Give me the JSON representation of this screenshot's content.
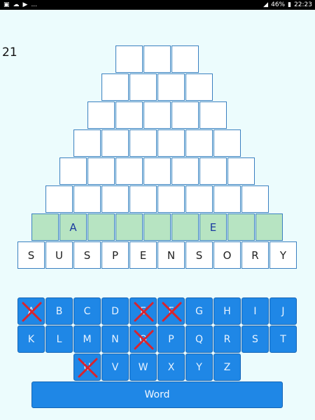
{
  "status_bar": {
    "left_icons": [
      "image-icon",
      "cloud-icon",
      "play-icon"
    ],
    "left_more": "...",
    "battery": "46%",
    "time": "22:23"
  },
  "game": {
    "score": "21",
    "pyramid_rows": [
      {
        "cells": [
          "",
          "",
          ""
        ],
        "style": "plain"
      },
      {
        "cells": [
          "",
          "",
          "",
          ""
        ],
        "style": "plain"
      },
      {
        "cells": [
          "",
          "",
          "",
          "",
          ""
        ],
        "style": "plain"
      },
      {
        "cells": [
          "",
          "",
          "",
          "",
          "",
          ""
        ],
        "style": "plain"
      },
      {
        "cells": [
          "",
          "",
          "",
          "",
          "",
          "",
          ""
        ],
        "style": "plain"
      },
      {
        "cells": [
          "",
          "",
          "",
          "",
          "",
          "",
          "",
          ""
        ],
        "style": "plain"
      },
      {
        "cells": [
          "",
          "A",
          "",
          "",
          "",
          "",
          "E",
          "",
          ""
        ],
        "style": "green"
      },
      {
        "cells": [
          "S",
          "U",
          "S",
          "P",
          "E",
          "N",
          "S",
          "O",
          "R",
          "Y"
        ],
        "style": "plain"
      }
    ],
    "keyboard_rows": [
      [
        {
          "label": "A",
          "used": true
        },
        {
          "label": "B",
          "used": false
        },
        {
          "label": "C",
          "used": false
        },
        {
          "label": "D",
          "used": false
        },
        {
          "label": "E",
          "used": true
        },
        {
          "label": "F",
          "used": true
        },
        {
          "label": "G",
          "used": false
        },
        {
          "label": "H",
          "used": false
        },
        {
          "label": "I",
          "used": false
        },
        {
          "label": "J",
          "used": false
        }
      ],
      [
        {
          "label": "K",
          "used": false
        },
        {
          "label": "L",
          "used": false
        },
        {
          "label": "M",
          "used": false
        },
        {
          "label": "N",
          "used": false
        },
        {
          "label": "O",
          "used": true
        },
        {
          "label": "P",
          "used": false
        },
        {
          "label": "Q",
          "used": false
        },
        {
          "label": "R",
          "used": false
        },
        {
          "label": "S",
          "used": false
        },
        {
          "label": "T",
          "used": false
        }
      ],
      [
        {
          "label": "U",
          "used": true
        },
        {
          "label": "V",
          "used": false
        },
        {
          "label": "W",
          "used": false
        },
        {
          "label": "X",
          "used": false
        },
        {
          "label": "Y",
          "used": false
        },
        {
          "label": "Z",
          "used": false
        }
      ]
    ],
    "word_button": "Word",
    "used_mark_color": "#d8242e"
  }
}
